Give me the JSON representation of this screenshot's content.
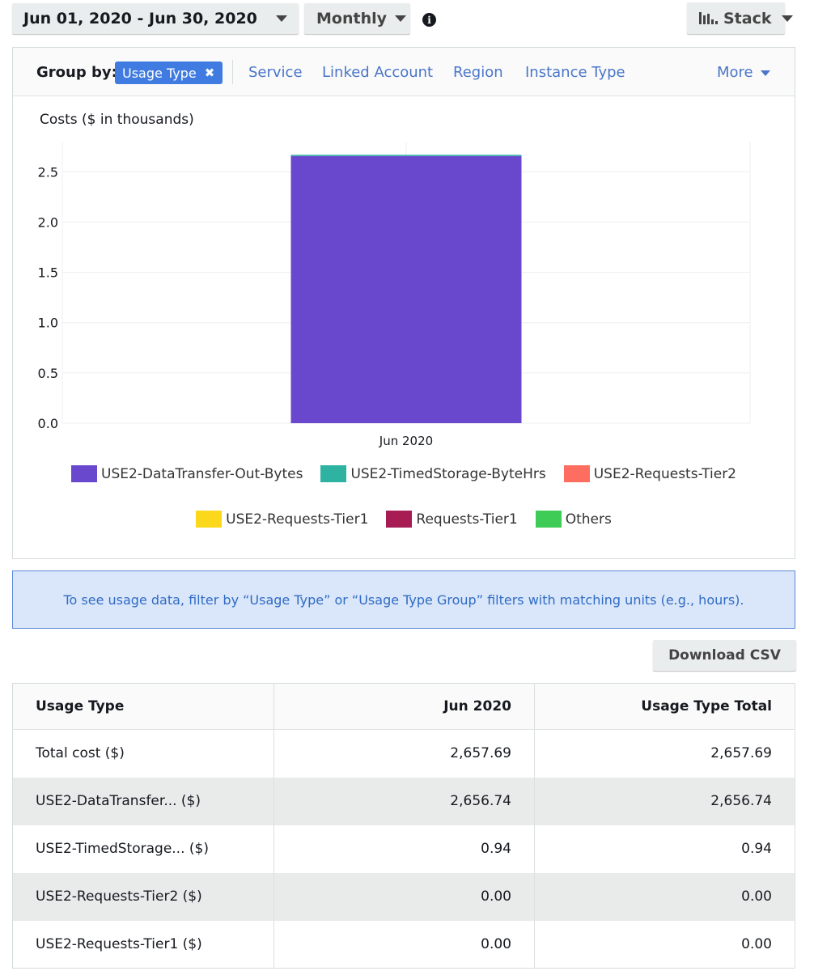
{
  "toolbar": {
    "date_range": "Jun 01, 2020 - Jun 30, 2020",
    "granularity": "Monthly",
    "chart_style": "Stack",
    "info_icon": "info-circle-icon",
    "stack_icon": "stacked-bars-icon"
  },
  "group_by": {
    "label": "Group by:",
    "active_chip": "Usage Type",
    "chip_remove_icon": "✖",
    "options": [
      "Service",
      "Linked Account",
      "Region",
      "Instance Type"
    ],
    "more_label": "More"
  },
  "chart_data": {
    "type": "bar",
    "stacked": true,
    "title": "Costs ($ in thousands)",
    "xlabel": "",
    "ylabel": "Costs ($ in thousands)",
    "categories": [
      "Jun 2020"
    ],
    "ylim": [
      0,
      2.8
    ],
    "yticks": [
      "0.0",
      "0.5",
      "1.0",
      "1.5",
      "2.0",
      "2.5"
    ],
    "grid": true,
    "legend_position": "bottom",
    "series": [
      {
        "name": "USE2-DataTransfer-Out-Bytes",
        "color": "#6a48cd",
        "values": [
          2.65674
        ]
      },
      {
        "name": "USE2-TimedStorage-ByteHrs",
        "color": "#2eb3a2",
        "values": [
          0.00094
        ]
      },
      {
        "name": "USE2-Requests-Tier2",
        "color": "#fe6e60",
        "values": [
          0.0
        ]
      },
      {
        "name": "USE2-Requests-Tier1",
        "color": "#fcd81d",
        "values": [
          0.0
        ]
      },
      {
        "name": "Requests-Tier1",
        "color": "#a61c53",
        "values": [
          0.0
        ]
      },
      {
        "name": "Others",
        "color": "#3fcc56",
        "values": [
          0.0
        ]
      }
    ]
  },
  "banner": {
    "text": "To see usage data, filter by “Usage Type” or “Usage Type Group” filters with matching units (e.g., hours)."
  },
  "download_csv": "Download CSV",
  "table": {
    "headers": [
      "Usage Type",
      "Jun 2020",
      "Usage Type Total"
    ],
    "rows": [
      [
        "Total cost ($)",
        "2,657.69",
        "2,657.69"
      ],
      [
        "USE2-DataTransfer... ($)",
        "2,656.74",
        "2,656.74"
      ],
      [
        "USE2-TimedStorage... ($)",
        "0.94",
        "0.94"
      ],
      [
        "USE2-Requests-Tier2 ($)",
        "0.00",
        "0.00"
      ],
      [
        "USE2-Requests-Tier1 ($)",
        "0.00",
        "0.00"
      ]
    ]
  }
}
